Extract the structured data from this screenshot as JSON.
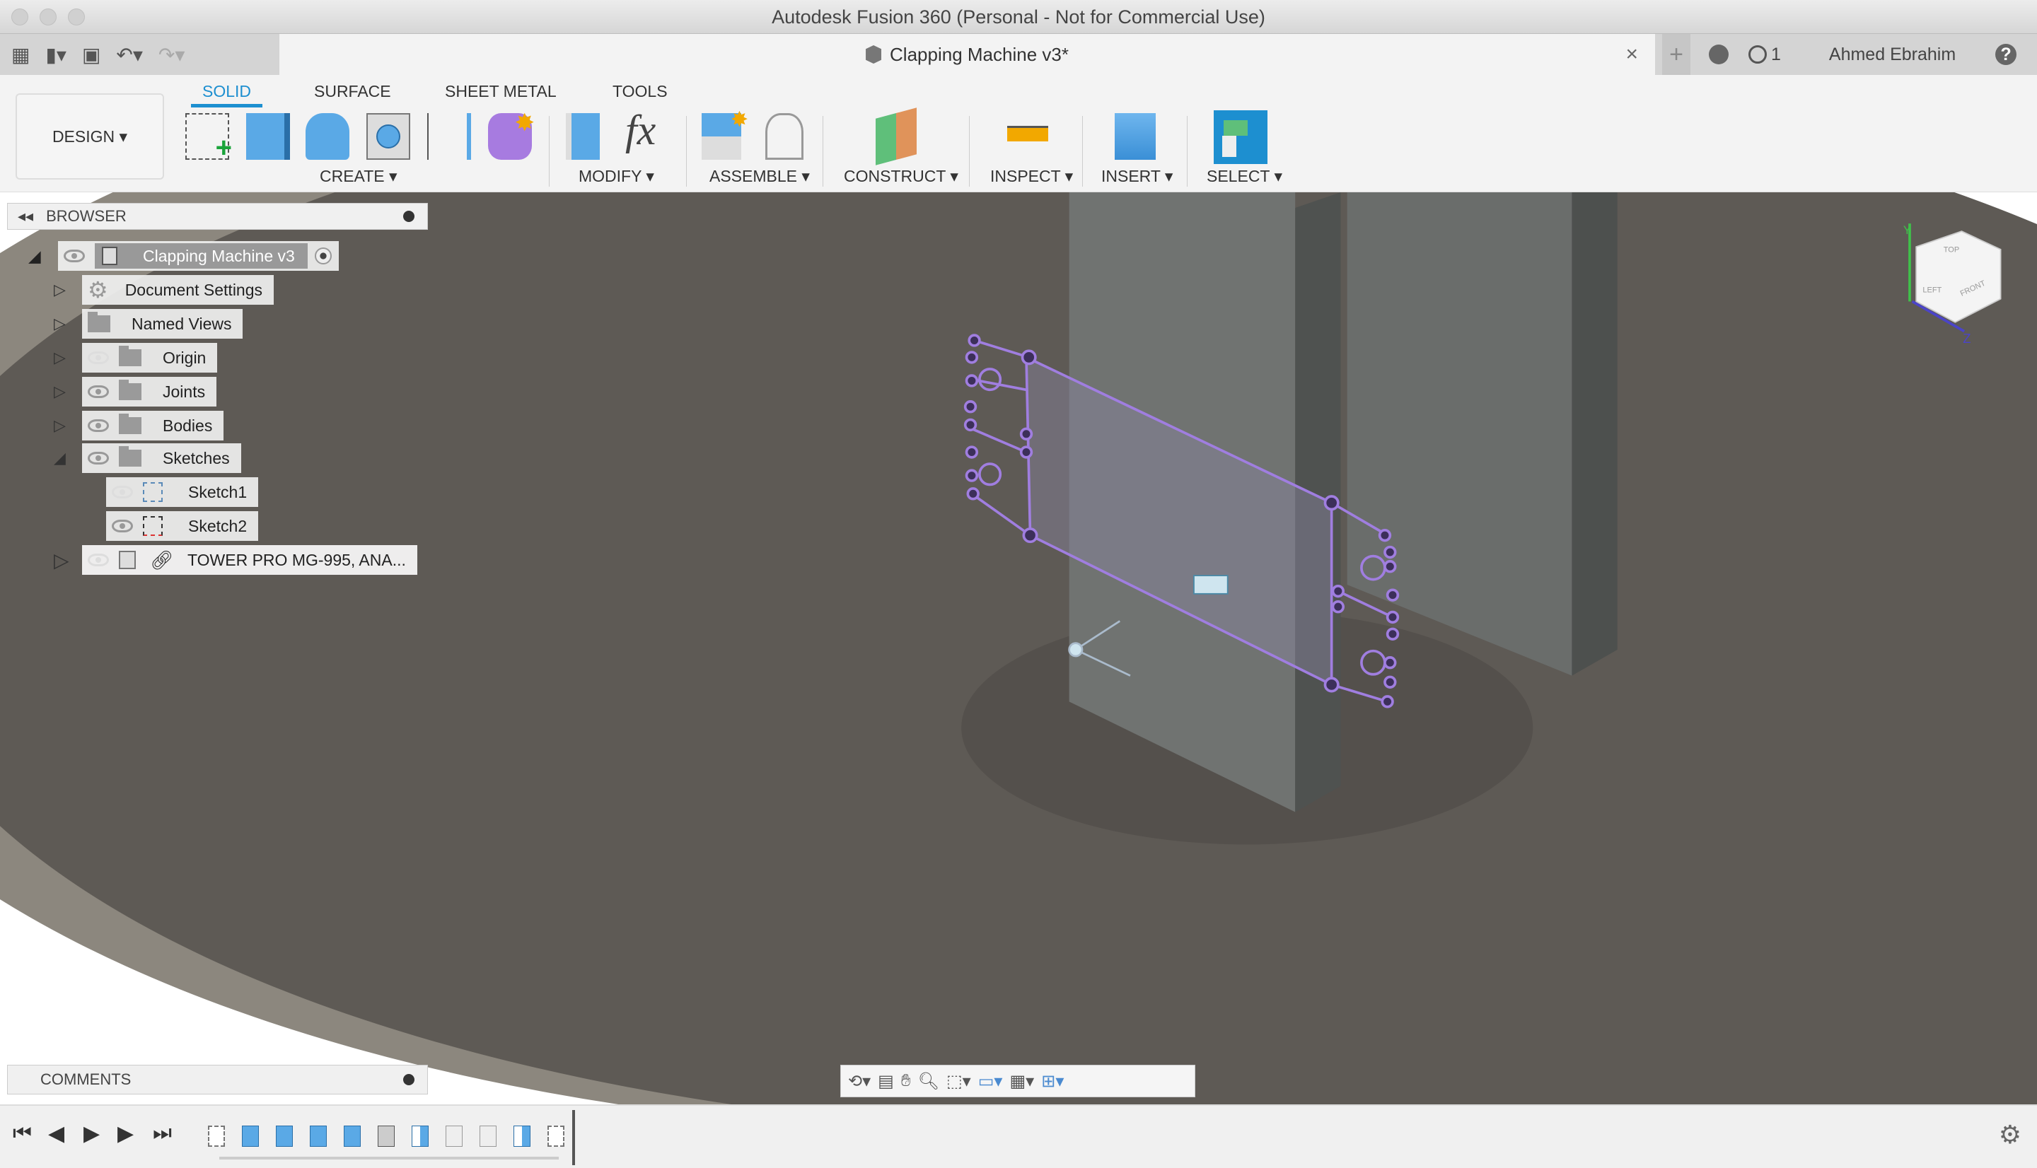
{
  "window": {
    "title": "Autodesk Fusion 360 (Personal - Not for Commercial Use)"
  },
  "quick_access": {
    "icons": [
      "grid-icon",
      "file-icon",
      "save-icon",
      "undo-icon",
      "redo-icon"
    ]
  },
  "document_tab": {
    "title": "Clapping Machine v3*",
    "close": "×"
  },
  "account": {
    "jobs_count": "1",
    "user": "Ahmed Ebrahim",
    "help": "?",
    "new_tab": "+"
  },
  "toolbar": {
    "workspace": "DESIGN ▾",
    "tabs": [
      "SOLID",
      "SURFACE",
      "SHEET METAL",
      "TOOLS"
    ],
    "active_tab": "SOLID",
    "groups": {
      "create": "CREATE ▾",
      "modify": "MODIFY ▾",
      "assemble": "ASSEMBLE ▾",
      "construct": "CONSTRUCT ▾",
      "inspect": "INSPECT ▾",
      "insert": "INSERT ▾",
      "select": "SELECT ▾"
    }
  },
  "browser": {
    "title": "BROWSER",
    "root": "Clapping Machine v3",
    "items": [
      {
        "label": "Document Settings"
      },
      {
        "label": "Named Views"
      },
      {
        "label": "Origin"
      },
      {
        "label": "Joints"
      },
      {
        "label": "Bodies"
      },
      {
        "label": "Sketches"
      },
      {
        "label": "Sketch1"
      },
      {
        "label": "Sketch2"
      },
      {
        "label": "TOWER PRO MG-995, ANA..."
      }
    ]
  },
  "viewcube": {
    "top": "TOP",
    "left": "LEFT",
    "front": "FRONT",
    "axis_y": "Y",
    "axis_z": "Z"
  },
  "comments": {
    "title": "COMMENTS"
  },
  "colors": {
    "accent": "#1d8fd0",
    "sketch": "#a07ee0",
    "body": "#5e5a55"
  }
}
